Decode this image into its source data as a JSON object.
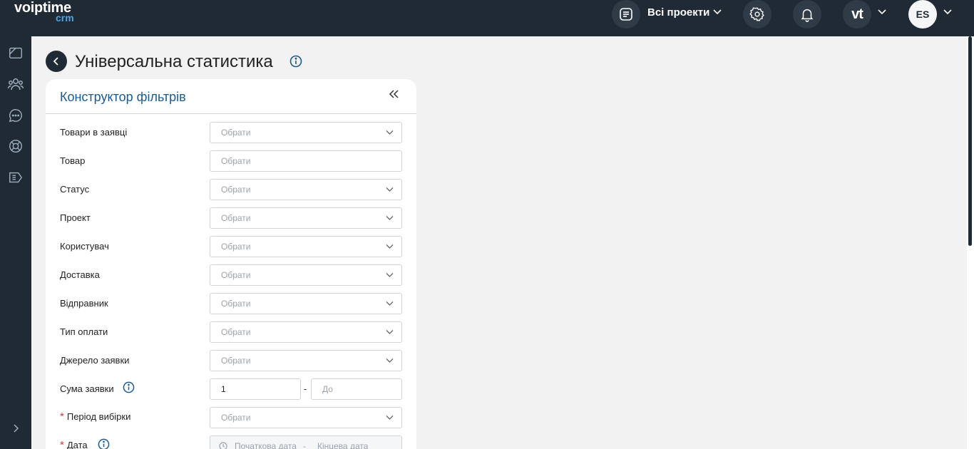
{
  "app": {
    "logo_main": "voiptime",
    "logo_sub": "crm"
  },
  "topbar": {
    "projects_label": "Всі проекти",
    "vt_label": "vt",
    "user_initials": "ES"
  },
  "page": {
    "title": "Універсальна статистика"
  },
  "panel": {
    "title": "Конструктор фільтрів",
    "placeholder": "Обрати",
    "filters": [
      {
        "label": "Товари в заявці",
        "placeholder": "Обрати"
      },
      {
        "label": "Товар",
        "placeholder": "Обрати"
      },
      {
        "label": "Статус",
        "placeholder": "Обрати"
      },
      {
        "label": "Проект",
        "placeholder": "Обрати"
      },
      {
        "label": "Користувач",
        "placeholder": "Обрати"
      },
      {
        "label": "Доставка",
        "placeholder": "Обрати"
      },
      {
        "label": "Відправник",
        "placeholder": "Обрати"
      },
      {
        "label": "Тип оплати",
        "placeholder": "Обрати"
      },
      {
        "label": "Джерело заявки",
        "placeholder": "Обрати"
      }
    ],
    "amount": {
      "label": "Сума заявки",
      "from_value": "1",
      "to_placeholder": "До",
      "separator": "-"
    },
    "period": {
      "required_mark": "*",
      "label": "Період вибірки",
      "placeholder": "Обрати"
    },
    "date": {
      "required_mark": "*",
      "label": "Дата",
      "start_placeholder": "Початкова дата",
      "separator": "-",
      "end_placeholder": "Кінцева дата"
    }
  },
  "colors": {
    "topbar_bg": "#1f2a34",
    "accent_blue": "#1b5b8e",
    "required_red": "#d63a3a"
  }
}
